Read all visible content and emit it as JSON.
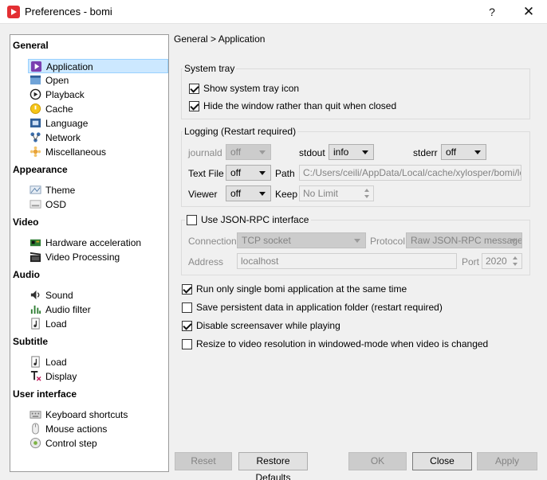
{
  "window": {
    "title": "Preferences - bomi",
    "help_glyph": "?",
    "close_glyph": "✕"
  },
  "nav": {
    "groups": [
      {
        "label": "General",
        "items": [
          {
            "label": "Application",
            "icon": "application-icon",
            "selected": true
          },
          {
            "label": "Open",
            "icon": "open-icon"
          },
          {
            "label": "Playback",
            "icon": "playback-icon"
          },
          {
            "label": "Cache",
            "icon": "cache-icon"
          },
          {
            "label": "Language",
            "icon": "language-icon"
          },
          {
            "label": "Network",
            "icon": "network-icon"
          },
          {
            "label": "Miscellaneous",
            "icon": "miscellaneous-icon"
          }
        ]
      },
      {
        "label": "Appearance",
        "items": [
          {
            "label": "Theme",
            "icon": "theme-icon"
          },
          {
            "label": "OSD",
            "icon": "osd-icon"
          }
        ]
      },
      {
        "label": "Video",
        "items": [
          {
            "label": "Hardware acceleration",
            "icon": "hardware-acceleration-icon"
          },
          {
            "label": "Video Processing",
            "icon": "video-processing-icon"
          }
        ]
      },
      {
        "label": "Audio",
        "items": [
          {
            "label": "Sound",
            "icon": "sound-icon"
          },
          {
            "label": "Audio filter",
            "icon": "audio-filter-icon"
          },
          {
            "label": "Load",
            "icon": "audio-load-icon"
          }
        ]
      },
      {
        "label": "Subtitle",
        "items": [
          {
            "label": "Load",
            "icon": "subtitle-load-icon"
          },
          {
            "label": "Display",
            "icon": "subtitle-display-icon"
          }
        ]
      },
      {
        "label": "User interface",
        "items": [
          {
            "label": "Keyboard shortcuts",
            "icon": "keyboard-icon"
          },
          {
            "label": "Mouse actions",
            "icon": "mouse-icon"
          },
          {
            "label": "Control step",
            "icon": "control-step-icon"
          }
        ]
      }
    ]
  },
  "breadcrumb": "General > Application",
  "system_tray": {
    "title": "System tray",
    "show_icon": {
      "label": "Show system tray icon",
      "checked": true
    },
    "hide_window": {
      "label": "Hide the window rather than quit when closed",
      "checked": true
    }
  },
  "logging": {
    "title": "Logging (Restart required)",
    "journald_label": "journald",
    "journald_value": "off",
    "stdout_label": "stdout",
    "stdout_value": "info",
    "stderr_label": "stderr",
    "stderr_value": "off",
    "textfile_label": "Text File",
    "textfile_value": "off",
    "path_label": "Path",
    "path_value": "C:/Users/ceili/AppData/Local/cache/xylosper/bomi/log",
    "viewer_label": "Viewer",
    "viewer_value": "off",
    "keep_label": "Keep",
    "keep_value": "No Limit"
  },
  "jsonrpc": {
    "label": "Use JSON-RPC interface",
    "checked": false,
    "connection_label": "Connection",
    "connection_value": "TCP socket",
    "protocol_label": "Protocol",
    "protocol_value": "Raw JSON-RPC message",
    "address_label": "Address",
    "address_value": "localhost",
    "port_label": "Port",
    "port_value": "2020"
  },
  "options": [
    {
      "label": "Run only single bomi application at the same time",
      "checked": true
    },
    {
      "label": "Save persistent data in application folder (restart required)",
      "checked": false
    },
    {
      "label": "Disable screensaver while playing",
      "checked": true
    },
    {
      "label": "Resize to video resolution in windowed-mode when video is changed",
      "checked": false
    }
  ],
  "buttons": {
    "reset": "Reset",
    "restore_defaults": "Restore Defaults",
    "ok": "OK",
    "close": "Close",
    "apply": "Apply"
  },
  "colors": {
    "selection_bg": "#cce8ff",
    "selection_border": "#99d1ff",
    "app_icon": "#e32f33"
  }
}
